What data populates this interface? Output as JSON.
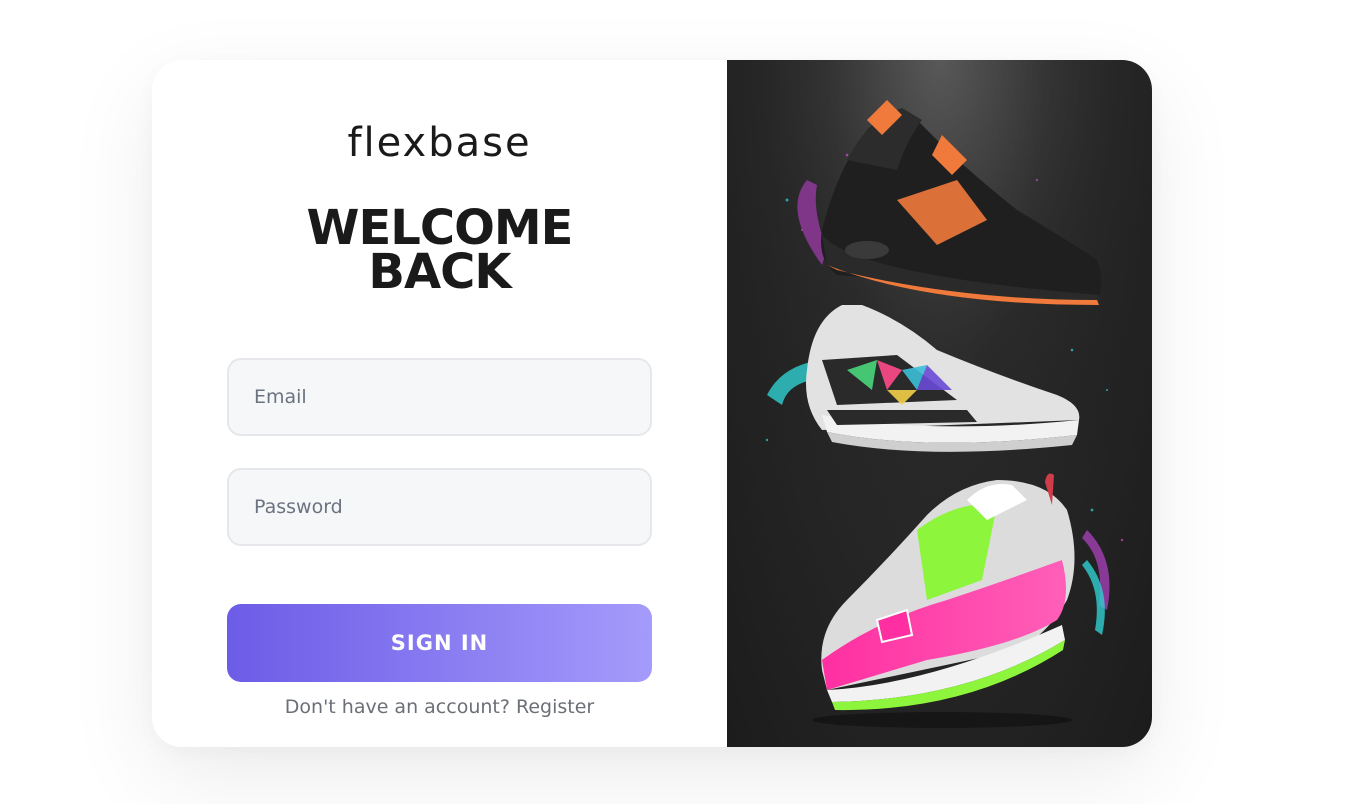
{
  "brand": {
    "logo_text": "flexbase"
  },
  "login": {
    "heading_line1": "WELCOME",
    "heading_line2": "BACK",
    "email_placeholder": "Email",
    "password_placeholder": "Password",
    "signin_label": "SIGN IN",
    "no_account_text": "Don't have an account?",
    "register_link": "Register"
  },
  "hero": {
    "image_description_icon": "sneakers-image",
    "colors": {
      "accent_purple_start": "#6c5ce7",
      "accent_purple_end": "#a49bfb",
      "shoe1_body": "#1d1d1d",
      "shoe1_accent": "#f07a3c",
      "shoe2_body": "#d9d9d9",
      "shoe3_body": "#ff2fa1",
      "shoe3_accent": "#8cf53c"
    }
  }
}
